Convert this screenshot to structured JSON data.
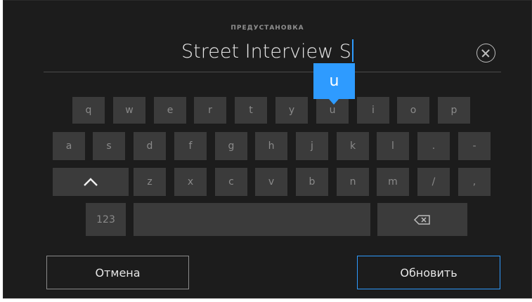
{
  "header": {
    "label": "ПРЕДУСТАНОВКА"
  },
  "input": {
    "value": "Street Interview S"
  },
  "keyboard": {
    "popup_key": "u",
    "row1": [
      "q",
      "w",
      "e",
      "r",
      "t",
      "y",
      "u",
      "i",
      "o",
      "p"
    ],
    "row2": [
      "a",
      "s",
      "d",
      "f",
      "g",
      "h",
      "j",
      "k",
      "l",
      ".",
      "-"
    ],
    "row3": [
      "z",
      "x",
      "c",
      "v",
      "b",
      "n",
      "m",
      "/",
      ","
    ],
    "numbers_key": "123"
  },
  "footer": {
    "cancel_label": "Отмена",
    "update_label": "Обновить"
  },
  "colors": {
    "accent": "#2e9bff",
    "background": "#1c1c1c",
    "key": "#3b3b3b"
  },
  "icons": {
    "clear": "circle-x-icon",
    "shift": "caret-up-icon",
    "backspace": "backspace-icon"
  }
}
